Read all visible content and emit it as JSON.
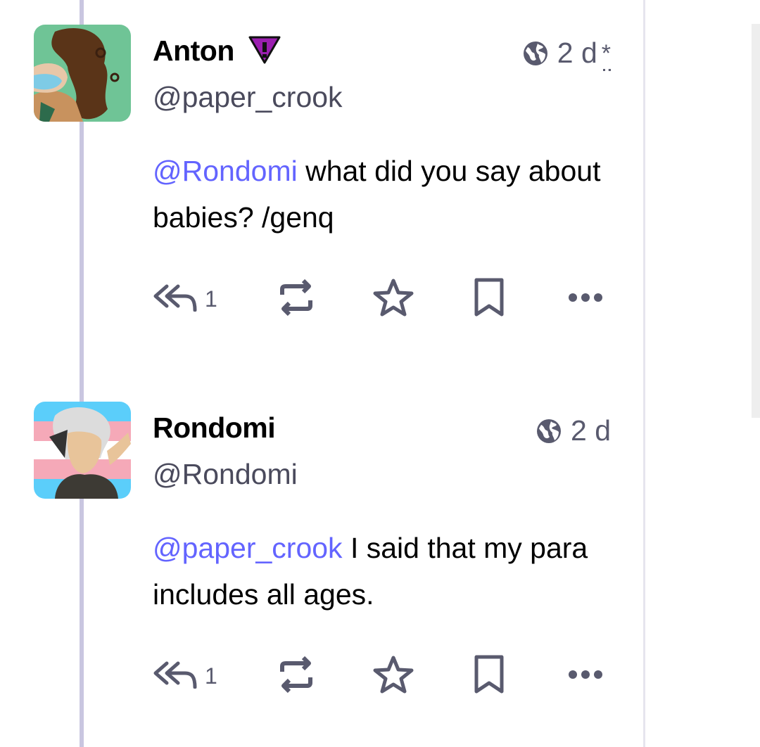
{
  "posts": [
    {
      "display_name": "Anton",
      "handle": "@paper_crook",
      "visibility_icon": "globe-icon",
      "time": "2 d",
      "edited_marker": "*",
      "mention": "@Rondomi",
      "text": " what did you say about babies? /genq",
      "reply_count": "1",
      "badge_icon": "warning-badge-icon",
      "badge_color": "#9b1fb0"
    },
    {
      "display_name": "Rondomi",
      "handle": "@Rondomi",
      "visibility_icon": "globe-icon",
      "time": "2 d",
      "mention": "@paper_crook",
      "text": " I said that my para includes all ages.",
      "reply_count": "1"
    }
  ],
  "colors": {
    "accent": "#6364ff",
    "icon": "#595a6e",
    "thread_line": "#c9c6e0"
  }
}
